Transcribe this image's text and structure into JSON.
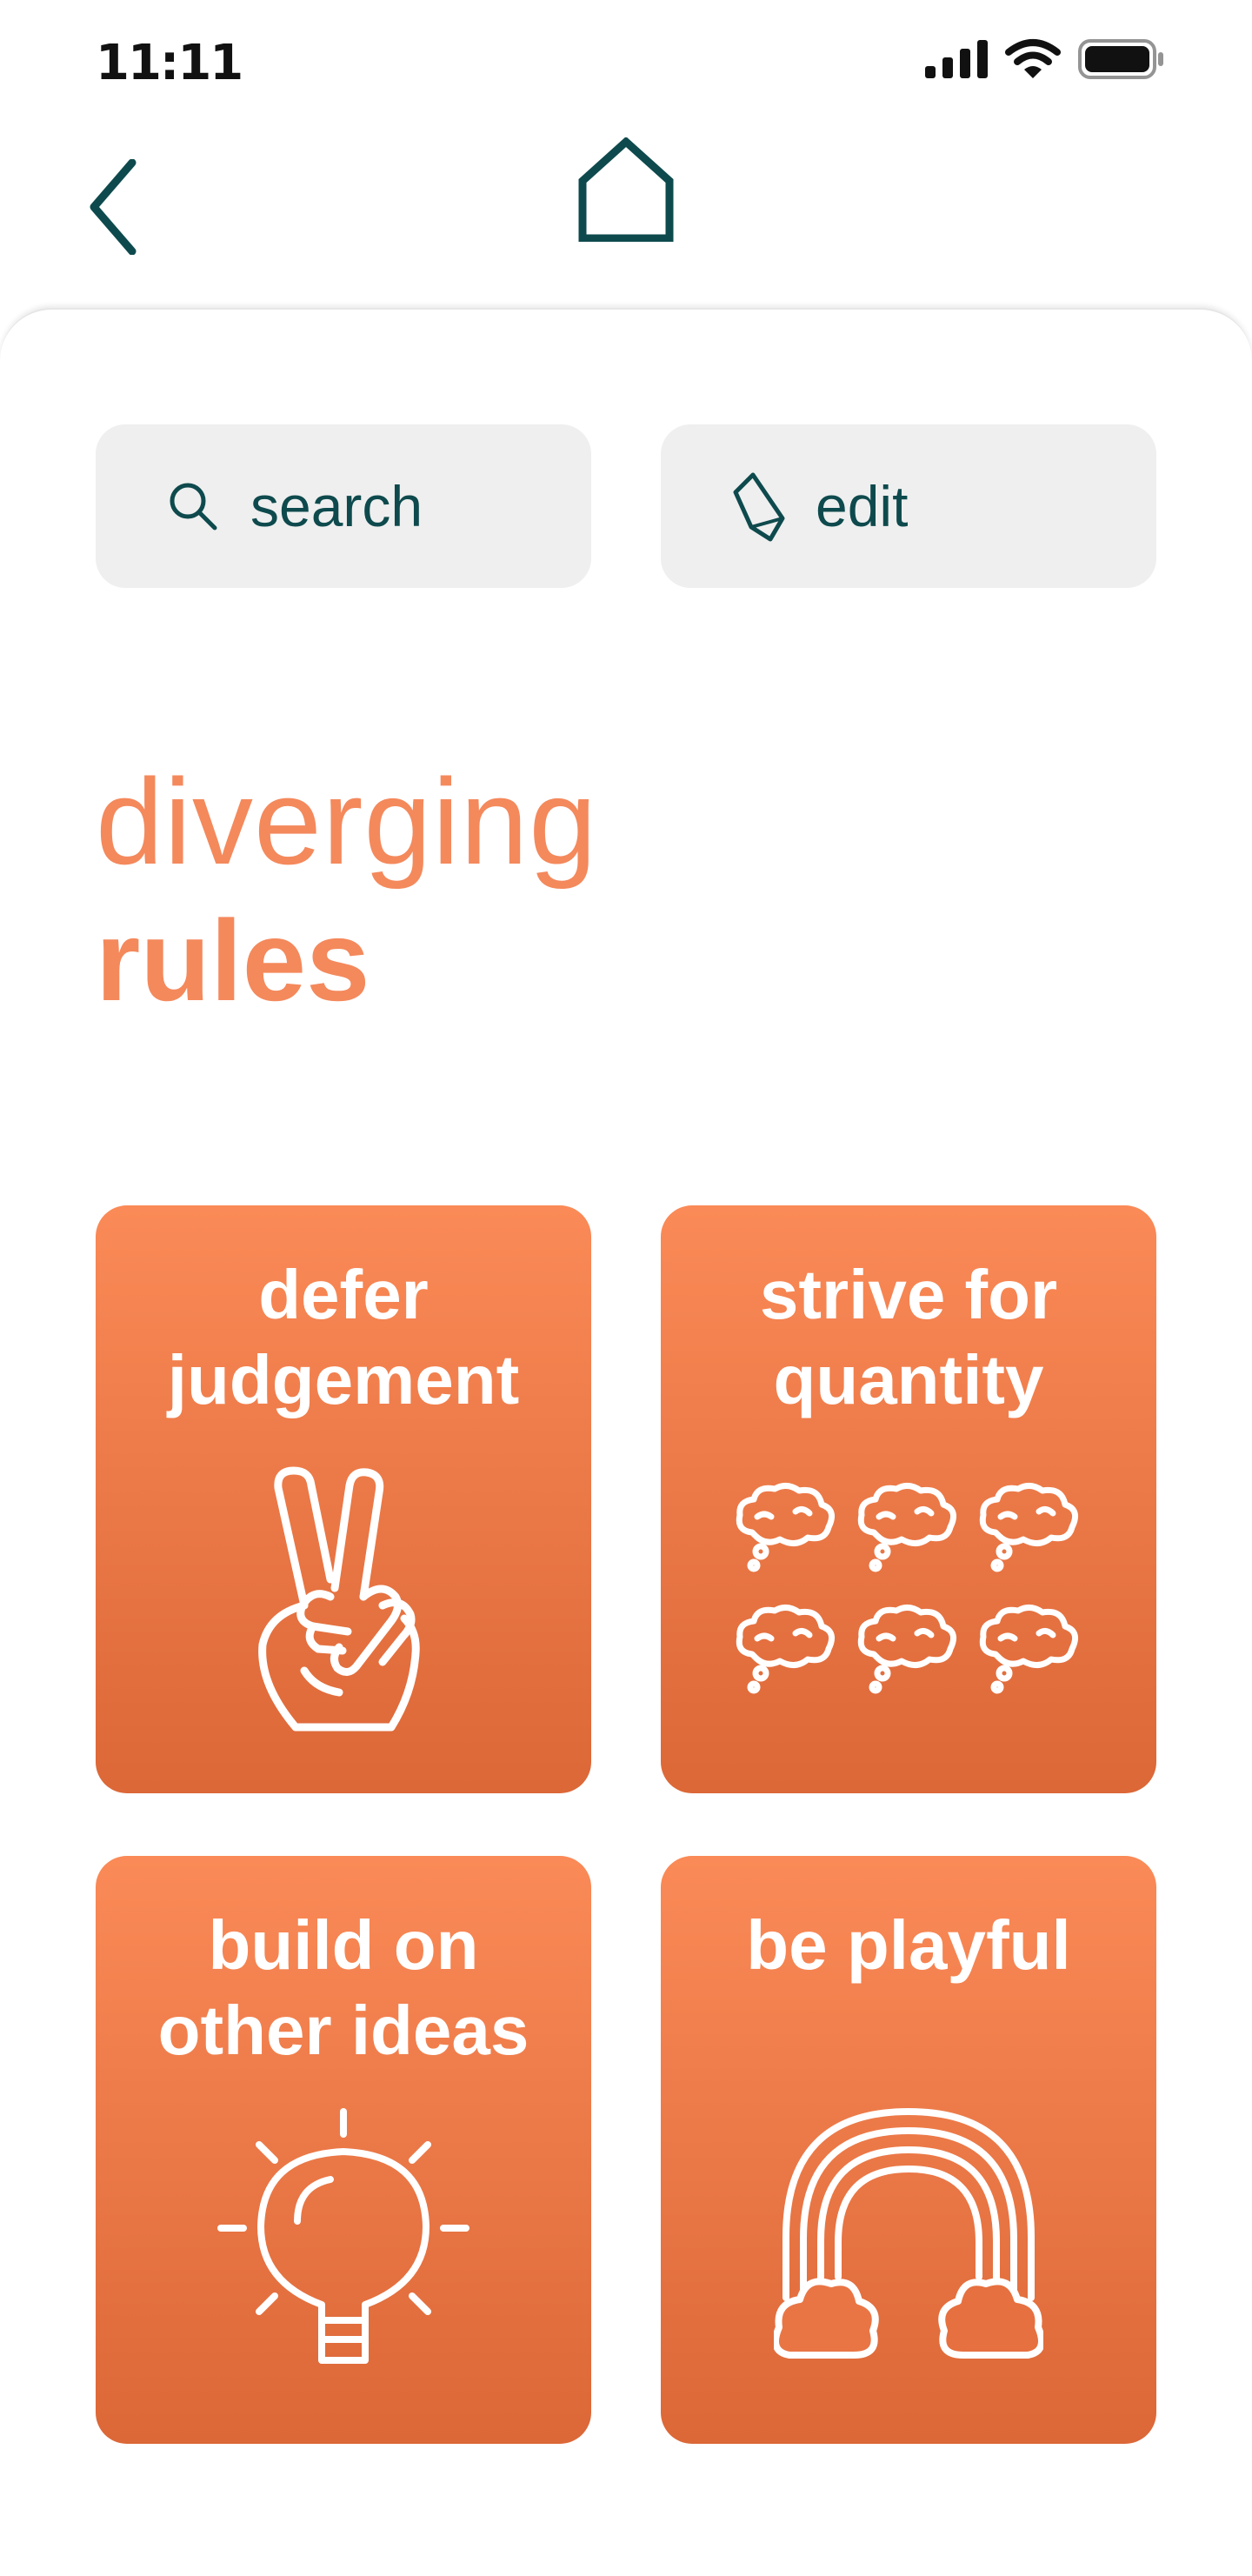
{
  "status_bar": {
    "time": "11:11",
    "icons": [
      "signal-icon",
      "wifi-icon",
      "battery-icon"
    ]
  },
  "nav": {
    "back_icon": "chevron-left-icon",
    "home_icon": "home-icon"
  },
  "actions": {
    "search": {
      "label": "search",
      "icon": "search-icon"
    },
    "edit": {
      "label": "edit",
      "icon": "pencil-icon"
    }
  },
  "heading": {
    "line1": "diverging",
    "line2": "rules"
  },
  "cards": [
    {
      "title": "defer\njudgement",
      "icon": "peace-hand-icon"
    },
    {
      "title": "strive for\nquantity",
      "icon": "thought-clouds-icon"
    },
    {
      "title": "build on\nother ideas",
      "icon": "lightbulb-icon"
    },
    {
      "title": "be playful",
      "icon": "rainbow-icon"
    }
  ],
  "colors": {
    "accent": "#f4895c",
    "card_top": "#fa8a57",
    "card_bottom": "#dc6737",
    "dark_teal": "#0e4a4d",
    "button_bg": "#efefef"
  }
}
